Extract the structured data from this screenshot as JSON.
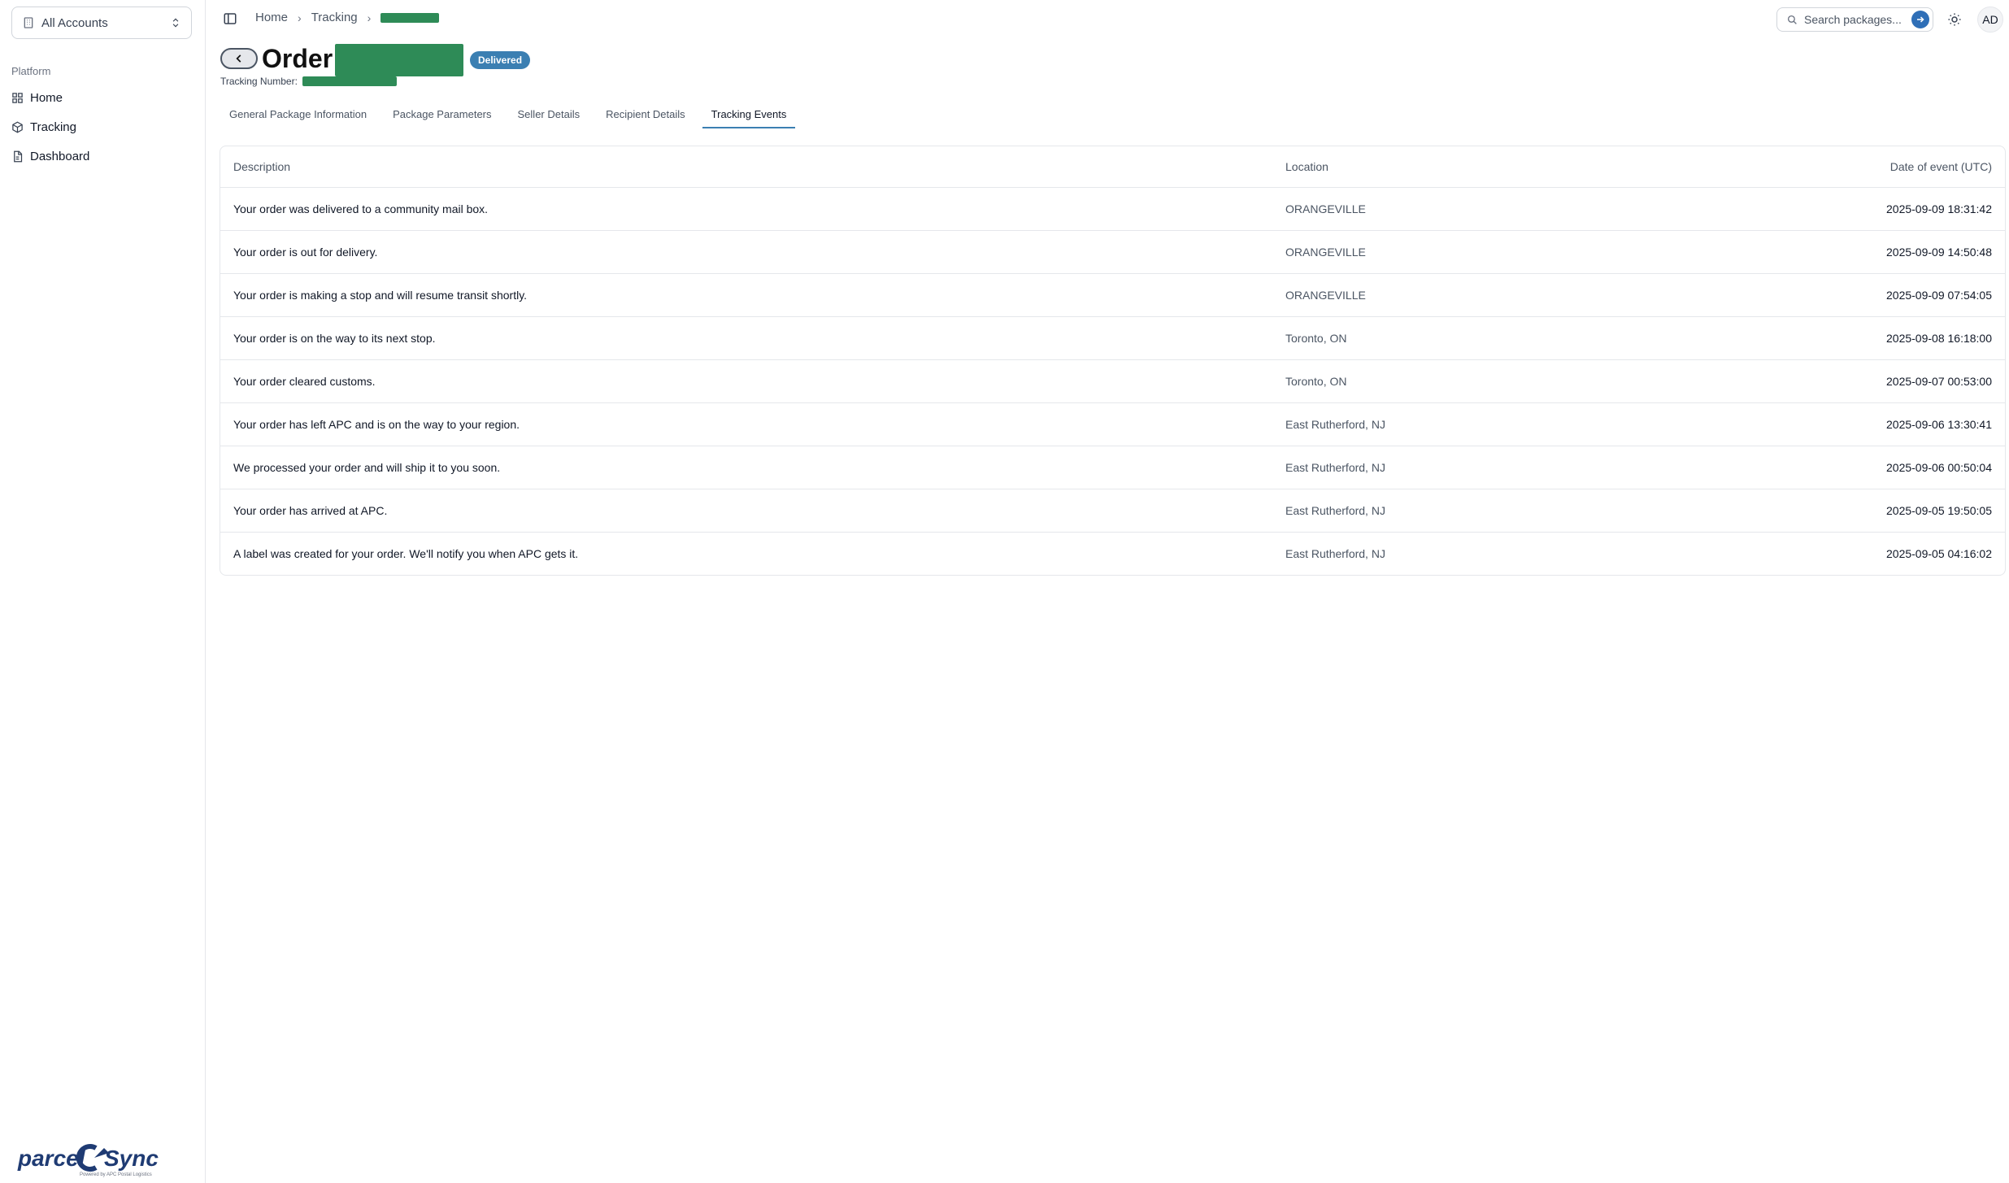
{
  "sidebar": {
    "account_selector": "All Accounts",
    "group_label": "Platform",
    "items": [
      {
        "label": "Home",
        "icon": "grid-icon"
      },
      {
        "label": "Tracking",
        "icon": "package-icon"
      },
      {
        "label": "Dashboard",
        "icon": "document-icon"
      }
    ],
    "logo_text": "parcelSync",
    "logo_tagline": "Powered by APC Postal Logistics"
  },
  "topbar": {
    "breadcrumbs": [
      "Home",
      "Tracking"
    ],
    "search_placeholder": "Search packages...",
    "avatar_initials": "AD"
  },
  "header": {
    "title": "Order",
    "status_badge": "Delivered",
    "tracking_label": "Tracking Number:"
  },
  "tabs": [
    {
      "label": "General Package Information",
      "active": false
    },
    {
      "label": "Package Parameters",
      "active": false
    },
    {
      "label": "Seller Details",
      "active": false
    },
    {
      "label": "Recipient Details",
      "active": false
    },
    {
      "label": "Tracking Events",
      "active": true
    }
  ],
  "events_table": {
    "columns": [
      "Description",
      "Location",
      "Date of event (UTC)"
    ],
    "rows": [
      {
        "description": "Your order was delivered to a community mail box.",
        "location": "ORANGEVILLE",
        "date": "2025-09-09 18:31:42"
      },
      {
        "description": "Your order is out for delivery.",
        "location": "ORANGEVILLE",
        "date": "2025-09-09 14:50:48"
      },
      {
        "description": "Your order is making a stop and will resume transit shortly.",
        "location": "ORANGEVILLE",
        "date": "2025-09-09 07:54:05"
      },
      {
        "description": "Your order is on the way to its next stop.",
        "location": "Toronto, ON",
        "date": "2025-09-08 16:18:00"
      },
      {
        "description": "Your order cleared customs.",
        "location": "Toronto, ON",
        "date": "2025-09-07 00:53:00"
      },
      {
        "description": "Your order has left APC and is on the way to your region.",
        "location": "East Rutherford, NJ",
        "date": "2025-09-06 13:30:41"
      },
      {
        "description": "We processed your order and will ship it to you soon.",
        "location": "East Rutherford, NJ",
        "date": "2025-09-06 00:50:04"
      },
      {
        "description": "Your order has arrived at APC.",
        "location": "East Rutherford, NJ",
        "date": "2025-09-05 19:50:05"
      },
      {
        "description": "A label was created for your order. We'll notify you when APC gets it.",
        "location": "East Rutherford, NJ",
        "date": "2025-09-05 04:16:02"
      }
    ]
  },
  "colors": {
    "accent": "#3b7fb2",
    "badge": "#3b7fb2",
    "redaction": "#2e8b57",
    "logo": "#1f3b73"
  }
}
